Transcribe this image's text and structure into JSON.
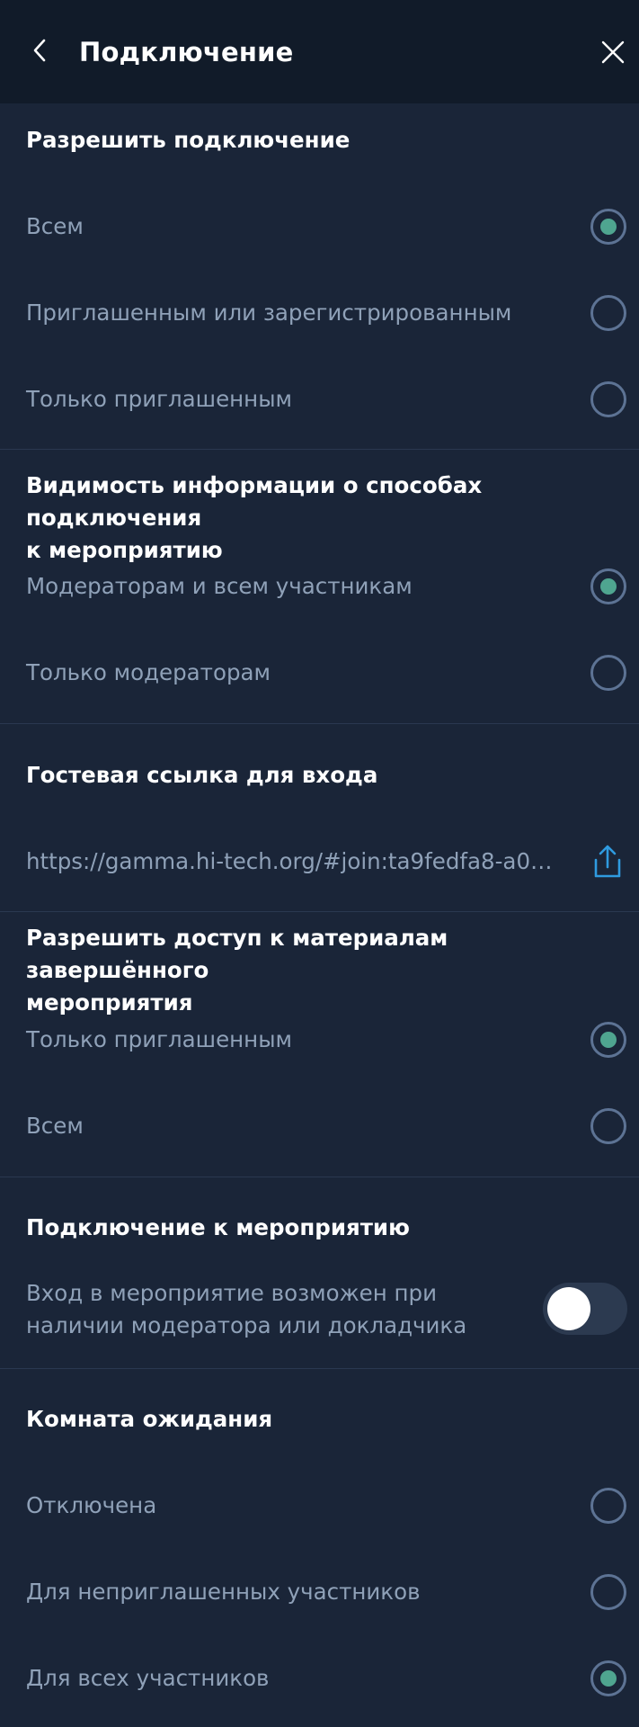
{
  "header": {
    "title": "Подключение"
  },
  "allow_connection": {
    "title": "Разрешить подключение",
    "options": [
      {
        "label": "Всем",
        "selected": true
      },
      {
        "label": "Приглашенным или зарегистрированным",
        "selected": false
      },
      {
        "label": "Только приглашенным",
        "selected": false
      }
    ]
  },
  "visibility": {
    "title_line1": "Видимость информации о способах подключения",
    "title_line2": "к мероприятию",
    "options": [
      {
        "label": "Модераторам и всем участникам",
        "selected": true
      },
      {
        "label": "Только модераторам",
        "selected": false
      }
    ]
  },
  "guest_link": {
    "title": "Гостевая ссылка для входа",
    "url": "https://gamma.hi-tech.org/#join:ta9fedfa8-a06..."
  },
  "materials_access": {
    "title_line1": "Разрешить доступ к материалам завершённого",
    "title_line2": "мероприятия",
    "options": [
      {
        "label": "Только приглашенным",
        "selected": true
      },
      {
        "label": "Всем",
        "selected": false
      }
    ]
  },
  "event_connection": {
    "title": "Подключение к мероприятию",
    "toggle_line1": "Вход в мероприятие возможен при",
    "toggle_line2": "наличии модератора или докладчика",
    "toggle_on": false
  },
  "waiting_room": {
    "title": "Комната ожидания",
    "options": [
      {
        "label": "Отключена",
        "selected": false
      },
      {
        "label": "Для неприглашенных участников",
        "selected": false
      },
      {
        "label": "Для всех участников",
        "selected": true
      }
    ]
  },
  "colors": {
    "background": "#1a2538",
    "topbar": "#111b29",
    "accent_green": "#4fa590",
    "link_blue": "#2f9be0",
    "muted_text": "#8fa1b8"
  },
  "icons": {
    "back": "chevron-left-icon",
    "close": "close-icon",
    "share": "share-icon"
  }
}
